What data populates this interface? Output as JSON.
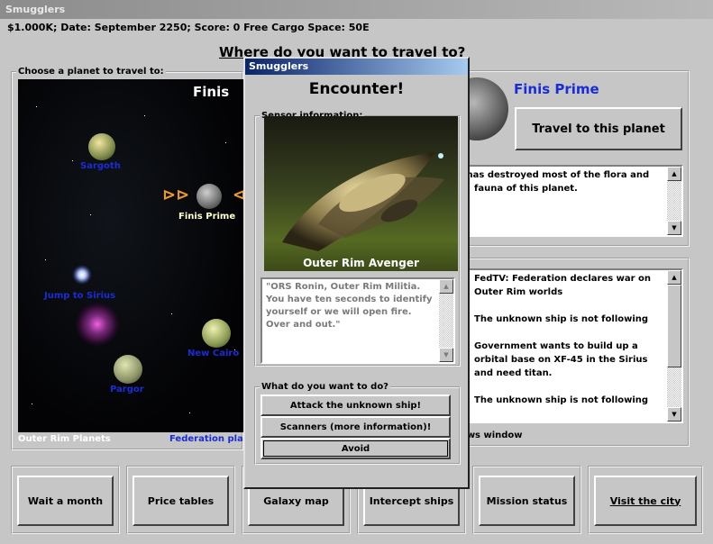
{
  "window_title": "Smugglers",
  "status_line": "$1.000K; Date: September 2250; Score: 0 Free Cargo Space: 50E",
  "heading": "Where do you want to travel to?",
  "map": {
    "legend": "Choose a planet to travel to:",
    "title": "Finis",
    "planets": [
      {
        "name": "Sargoth"
      },
      {
        "name": "Finis Prime"
      },
      {
        "name": "Jump to Sirius"
      },
      {
        "name": "New Cairo"
      },
      {
        "name": "Pargor"
      }
    ],
    "footer_left": "Outer Rim Planets",
    "footer_right": "Federation planets"
  },
  "planet_panel": {
    "name": "Finis Prime",
    "travel_button": "Travel to this planet",
    "description": "Industrial pollution has destroyed most of the flora and fauna of this planet."
  },
  "news": {
    "items": [
      "FedTV: Federation declares war on Outer Rim worlds",
      "The unknown ship is not following",
      "Government wants to build up a orbital base on XF-45 in the Sirius and need titan.",
      "The unknown ship is not following"
    ],
    "footer": "Show news window"
  },
  "dialog": {
    "title": "Smugglers",
    "heading": "Encounter!",
    "sensor_legend": "Sensor information:",
    "ship_name": "Outer Rim Avenger",
    "message": "\"ORS Ronin, Outer Rim Militia. You have ten seconds to identify yourself or we will open fire. Over and out.\"",
    "actions_legend": "What do you want to do?",
    "actions": [
      "Attack the unknown ship!",
      "Scanners (more information)!",
      "Avoid"
    ]
  },
  "bottom_buttons": [
    "Wait a month",
    "Price tables",
    "Galaxy map",
    "Intercept ships",
    "Mission status",
    "Visit the city"
  ]
}
